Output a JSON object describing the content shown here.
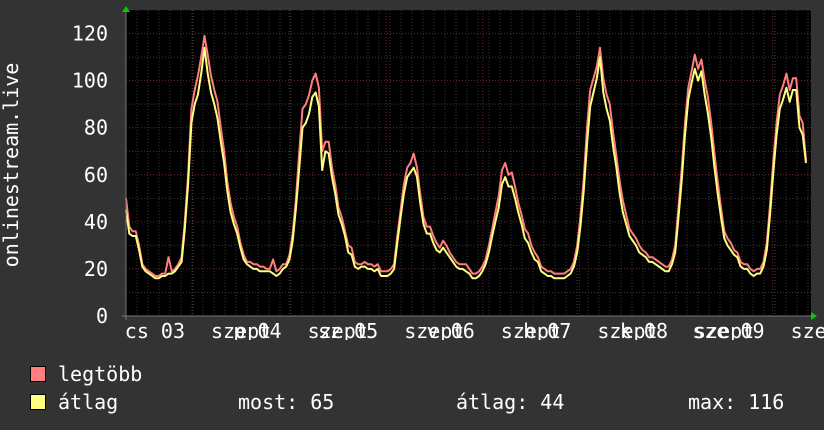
{
  "chart_data": {
    "type": "line",
    "ylabel": "onlinestream.live",
    "ylim": [
      0,
      130
    ],
    "yticks": [
      0,
      20,
      40,
      60,
      80,
      100,
      120
    ],
    "grid": true,
    "x_tick_labels": [
      "cs 03",
      "szept",
      "p 04",
      "szept",
      "sz 05",
      "szept",
      "v 06",
      "szept",
      "h 07",
      "szept",
      "k 08",
      "szept",
      "sze 09",
      "szept"
    ],
    "legend_placement": "bottom-left",
    "series": [
      {
        "name": "legtöbb",
        "color": "#ff7f7f",
        "values": [
          50,
          38,
          36,
          36,
          30,
          22,
          20,
          19,
          18,
          17,
          17,
          18,
          18,
          25,
          19,
          20,
          22,
          25,
          40,
          60,
          88,
          96,
          102,
          110,
          119,
          111,
          102,
          96,
          91,
          80,
          70,
          57,
          48,
          42,
          38,
          31,
          26,
          23,
          23,
          22,
          22,
          21,
          21,
          20,
          20,
          24,
          19,
          20,
          22,
          22,
          26,
          35,
          50,
          70,
          88,
          90,
          94,
          100,
          103,
          97,
          70,
          74,
          74,
          63,
          56,
          46,
          42,
          36,
          30,
          29,
          23,
          22,
          22,
          23,
          22,
          22,
          21,
          22,
          19,
          19,
          19,
          20,
          22,
          34,
          45,
          56,
          63,
          65,
          69,
          63,
          52,
          42,
          38,
          38,
          34,
          31,
          29,
          32,
          30,
          27,
          25,
          23,
          22,
          22,
          22,
          20,
          18,
          18,
          19,
          21,
          24,
          30,
          37,
          44,
          51,
          62,
          65,
          60,
          61,
          55,
          48,
          43,
          37,
          35,
          30,
          27,
          25,
          21,
          20,
          19,
          19,
          18,
          18,
          18,
          18,
          19,
          20,
          23,
          30,
          42,
          58,
          80,
          96,
          101,
          106,
          114,
          101,
          94,
          90,
          78,
          68,
          57,
          49,
          43,
          37,
          35,
          33,
          30,
          28,
          27,
          25,
          25,
          24,
          23,
          22,
          21,
          21,
          24,
          30,
          46,
          63,
          82,
          97,
          104,
          111,
          105,
          109,
          100,
          93,
          82,
          69,
          57,
          46,
          36,
          33,
          31,
          28,
          27,
          23,
          22,
          22,
          20,
          19,
          20,
          20,
          23,
          31,
          47,
          66,
          82,
          94,
          98,
          103,
          96,
          101,
          101,
          85,
          82,
          66
        ]
      },
      {
        "name": "átlag",
        "color": "#ffff7f",
        "values": [
          45,
          35,
          34,
          34,
          28,
          21,
          19,
          18,
          17,
          16,
          16,
          17,
          17,
          18,
          18,
          19,
          21,
          23,
          37,
          56,
          82,
          90,
          94,
          103,
          114,
          103,
          95,
          90,
          84,
          74,
          65,
          53,
          44,
          39,
          35,
          29,
          24,
          22,
          21,
          20,
          20,
          19,
          19,
          19,
          19,
          18,
          17,
          18,
          20,
          21,
          24,
          32,
          46,
          63,
          80,
          82,
          86,
          93,
          95,
          89,
          62,
          70,
          69,
          59,
          52,
          43,
          39,
          34,
          27,
          26,
          21,
          20,
          21,
          21,
          20,
          20,
          19,
          20,
          17,
          17,
          17,
          18,
          20,
          31,
          42,
          52,
          59,
          61,
          63,
          59,
          48,
          39,
          35,
          35,
          31,
          28,
          27,
          29,
          27,
          25,
          23,
          21,
          20,
          20,
          19,
          18,
          16,
          16,
          17,
          19,
          22,
          27,
          34,
          40,
          46,
          56,
          59,
          55,
          55,
          50,
          44,
          39,
          33,
          31,
          27,
          24,
          23,
          19,
          18,
          17,
          17,
          16,
          16,
          16,
          16,
          17,
          18,
          21,
          27,
          38,
          53,
          73,
          89,
          95,
          101,
          110,
          95,
          88,
          83,
          72,
          63,
          52,
          44,
          39,
          34,
          32,
          30,
          27,
          26,
          25,
          23,
          23,
          22,
          21,
          20,
          19,
          19,
          22,
          27,
          42,
          58,
          77,
          92,
          99,
          105,
          100,
          104,
          94,
          86,
          76,
          63,
          52,
          42,
          33,
          30,
          28,
          26,
          25,
          21,
          20,
          20,
          18,
          17,
          18,
          18,
          21,
          28,
          43,
          61,
          77,
          88,
          92,
          97,
          91,
          96,
          96,
          80,
          77,
          65
        ]
      }
    ],
    "stats": {
      "now_label": "most:",
      "now_value": "65",
      "avg_label": "átlag:",
      "avg_value": "44",
      "max_label": "max:",
      "max_value": "116"
    }
  }
}
